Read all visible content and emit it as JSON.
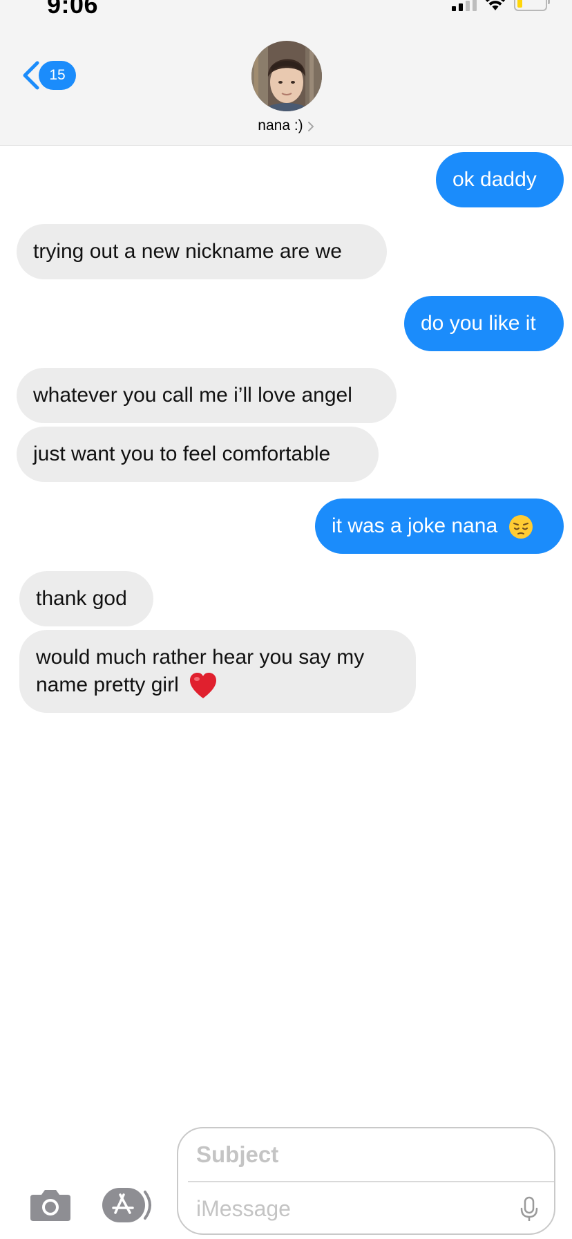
{
  "status_bar": {
    "time": "9:06",
    "icons": [
      "cellular-signal-icon",
      "wifi-icon",
      "battery-icon"
    ]
  },
  "header": {
    "back_badge_count": "15",
    "contact_name": "nana :)"
  },
  "messages": [
    {
      "sender": "me",
      "text": "ok daddy"
    },
    {
      "sender": "them",
      "text": "trying out a new nickname are we"
    },
    {
      "sender": "me",
      "text": "do you like it"
    },
    {
      "sender": "them",
      "text": "whatever you call me i’ll love angel"
    },
    {
      "sender": "them",
      "text": "just want you to feel comfortable"
    },
    {
      "sender": "me",
      "text": "it was a joke nana",
      "emoji": "pensive-face-emoji"
    },
    {
      "sender": "them",
      "text": "thank god"
    },
    {
      "sender": "them",
      "line1": "would much rather hear you say my",
      "line2": "name pretty girl",
      "emoji": "red-heart-emoji"
    }
  ],
  "composer": {
    "subject_placeholder": "Subject",
    "message_placeholder": "iMessage",
    "icons": [
      "camera-icon",
      "app-store-icon",
      "microphone-icon"
    ]
  },
  "colors": {
    "sent_bubble": "#1b8cfb",
    "received_bubble": "#ececec",
    "header_background": "#f4f4f4",
    "accent": "#1b8cfb"
  }
}
